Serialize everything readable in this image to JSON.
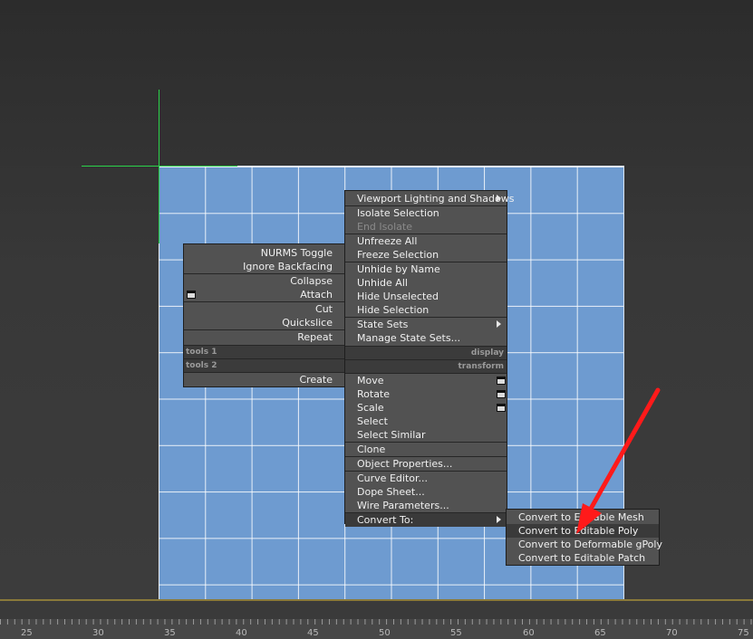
{
  "left_quad": {
    "items": [
      "NURMS Toggle",
      "Ignore Backfacing",
      "Collapse",
      "Attach",
      "Cut",
      "Quickslice",
      "Repeat"
    ],
    "header_tools1": "tools 1",
    "header_tools2": "tools 2",
    "create": "Create"
  },
  "right_quad": {
    "display_items": [
      "Viewport Lighting and Shadows",
      "Isolate Selection",
      "End Isolate",
      "Unfreeze All",
      "Freeze Selection",
      "Unhide by Name",
      "Unhide All",
      "Hide Unselected",
      "Hide Selection",
      "State Sets",
      "Manage State Sets..."
    ],
    "header_display": "display",
    "header_transform": "transform",
    "transform_items": [
      "Move",
      "Rotate",
      "Scale",
      "Select",
      "Select Similar",
      "Clone",
      "Object Properties...",
      "Curve Editor...",
      "Dope Sheet...",
      "Wire Parameters...",
      "Convert To:"
    ]
  },
  "convert_submenu": {
    "items": [
      "Convert to Editable Mesh",
      "Convert to Editable Poly",
      "Convert to Deformable gPoly",
      "Convert to Editable Patch"
    ]
  },
  "ruler": {
    "labels": [
      "25",
      "30",
      "35",
      "40",
      "45",
      "50",
      "55",
      "60",
      "65",
      "70",
      "75"
    ]
  },
  "colors": {
    "menu_bg": "#525252",
    "grid_plane": "#6e9bd0",
    "gizmo": "#2bd24a",
    "annotation_arrow": "#ff1a1a"
  }
}
